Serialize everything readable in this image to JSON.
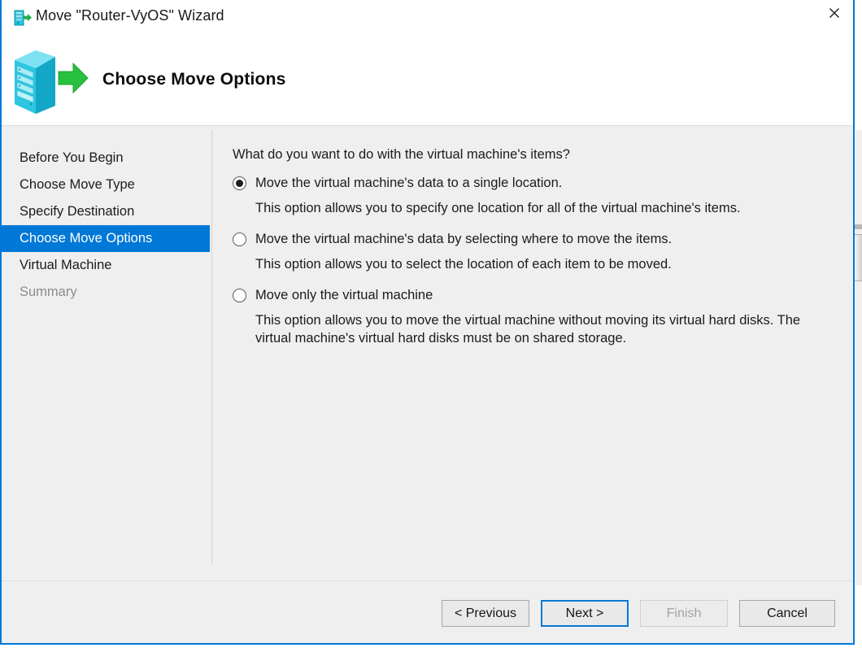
{
  "window": {
    "title": "Move \"Router-VyOS\" Wizard",
    "title_icon": "server-move-icon",
    "close_icon": "close-icon",
    "accent_color": "#0078d7",
    "body_background": "#efefef"
  },
  "header": {
    "title": "Choose Move Options",
    "icon": "server-move-banner-icon"
  },
  "steps": [
    {
      "label": "Before You Begin",
      "state": "completed"
    },
    {
      "label": "Choose Move Type",
      "state": "completed"
    },
    {
      "label": "Specify Destination",
      "state": "completed"
    },
    {
      "label": "Choose Move Options",
      "state": "selected"
    },
    {
      "label": "Virtual Machine",
      "state": "upcoming"
    },
    {
      "label": "Summary",
      "state": "disabled"
    }
  ],
  "main": {
    "question": "What do you want to do with the virtual machine's items?",
    "options": [
      {
        "label": "Move the virtual machine's data to a single location.",
        "description": "This option allows you to specify one location for all of the virtual machine's items.",
        "checked": true
      },
      {
        "label": "Move the virtual machine's data by selecting where to move the items.",
        "description": "This option allows you to select the location of each item to be moved.",
        "checked": false
      },
      {
        "label": "Move only the virtual machine",
        "description": "This option allows you to move the virtual machine without moving its virtual hard disks. The virtual machine's virtual hard disks must be on shared storage.",
        "checked": false
      }
    ]
  },
  "footer": {
    "previous_label": "< Previous",
    "next_label": "Next >",
    "finish_label": "Finish",
    "cancel_label": "Cancel",
    "finish_disabled": true,
    "next_is_default": true
  }
}
